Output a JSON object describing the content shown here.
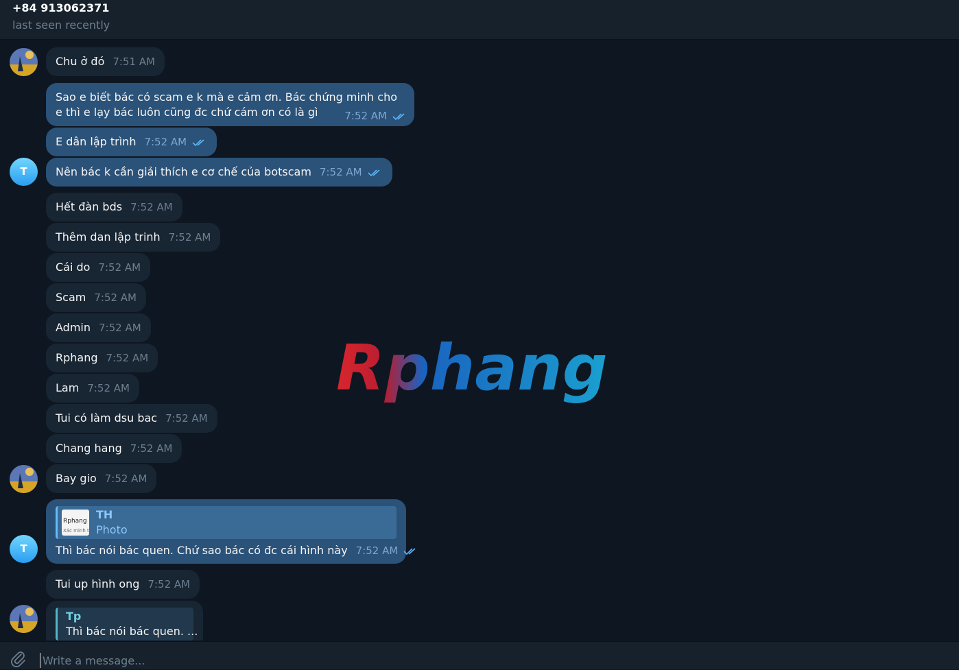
{
  "header": {
    "name": "+84 913062371",
    "status": "last seen recently"
  },
  "messages": [
    {
      "text": "Chu ở đó",
      "time": "7:51 AM"
    },
    {
      "text": "Sao e biết bác có scam e k mà e cảm ơn. Bác chứng minh cho e thì e lạy bác luôn cũng đc chứ cám ơn có là gì",
      "time": "7:52 AM"
    },
    {
      "text": "E dân lập trình",
      "time": "7:52 AM"
    },
    {
      "text": "Nên bác k cần giải thích e cơ chế của botscam",
      "time": "7:52 AM"
    },
    {
      "text": "Hết đàn bds",
      "time": "7:52 AM"
    },
    {
      "text": "Thêm dan lập trinh",
      "time": "7:52 AM"
    },
    {
      "text": "Cái do",
      "time": "7:52 AM"
    },
    {
      "text": "Scam",
      "time": "7:52 AM"
    },
    {
      "text": "Admin",
      "time": "7:52 AM"
    },
    {
      "text": "Rphang",
      "time": "7:52 AM"
    },
    {
      "text": "Lam",
      "time": "7:52 AM"
    },
    {
      "text": "Tui có làm dsu bac",
      "time": "7:52 AM"
    },
    {
      "text": "Chang hang",
      "time": "7:52 AM"
    },
    {
      "text": "Bay gio",
      "time": "7:52 AM"
    },
    {
      "text": "Thì bác nói bác quen. Chứ sao bác có đc cái hình này",
      "time": "7:52 AM",
      "reply": {
        "name": "TH",
        "type": "Photo",
        "thumb_title": "Rphang Xá",
        "thumb_sub": "Xác minh t"
      }
    },
    {
      "text": "Tui up hình ong",
      "time": "7:52 AM"
    },
    {
      "reply": {
        "name": "Tp",
        "text": "Thì bác nói bác quen. ..."
      }
    }
  ],
  "avatars": {
    "letter": "T"
  },
  "watermark": "Rphang",
  "composer": {
    "placeholder": "Write a message..."
  },
  "icons": {
    "attach": "paperclip-icon",
    "read": "double-check-icon"
  },
  "colors": {
    "background": "#0e1621",
    "incoming": "#182533",
    "outgoing": "#2b5278",
    "accent": "#62bcf9"
  }
}
